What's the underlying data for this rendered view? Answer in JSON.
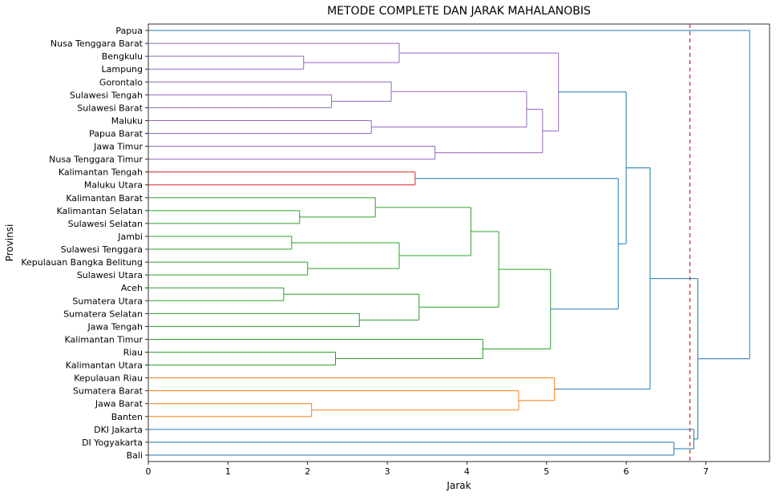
{
  "chart_data": {
    "type": "dendrogram",
    "title": "METODE COMPLETE DAN JARAK MAHALANOBIS",
    "xlabel": "Jarak",
    "ylabel": "Provinsi",
    "xlim": [
      0,
      7.8
    ],
    "xticks": [
      0,
      1,
      2,
      3,
      4,
      5,
      6,
      7
    ],
    "cut_line": 6.8,
    "colors": {
      "purple": "#9467bd",
      "red": "#d62728",
      "green": "#2ca02c",
      "orange": "#ff7f0e",
      "blue": "#1f77b4"
    },
    "leaves": [
      {
        "label": "Papua",
        "cluster": "blue"
      },
      {
        "label": "Nusa Tenggara Barat",
        "cluster": "purple"
      },
      {
        "label": "Bengkulu",
        "cluster": "purple"
      },
      {
        "label": "Lampung",
        "cluster": "purple"
      },
      {
        "label": "Gorontalo",
        "cluster": "purple"
      },
      {
        "label": "Sulawesi Tengah",
        "cluster": "purple"
      },
      {
        "label": "Sulawesi Barat",
        "cluster": "purple"
      },
      {
        "label": "Maluku",
        "cluster": "purple"
      },
      {
        "label": "Papua Barat",
        "cluster": "purple"
      },
      {
        "label": "Jawa Timur",
        "cluster": "purple"
      },
      {
        "label": "Nusa Tenggara Timur",
        "cluster": "purple"
      },
      {
        "label": "Kalimantan Tengah",
        "cluster": "red"
      },
      {
        "label": "Maluku Utara",
        "cluster": "red"
      },
      {
        "label": "Kalimantan Barat",
        "cluster": "green"
      },
      {
        "label": "Kalimantan Selatan",
        "cluster": "green"
      },
      {
        "label": "Sulawesi Selatan",
        "cluster": "green"
      },
      {
        "label": "Jambi",
        "cluster": "green"
      },
      {
        "label": "Sulawesi Tenggara",
        "cluster": "green"
      },
      {
        "label": "Kepulauan Bangka Belitung",
        "cluster": "green"
      },
      {
        "label": "Sulawesi Utara",
        "cluster": "green"
      },
      {
        "label": "Aceh",
        "cluster": "green"
      },
      {
        "label": "Sumatera Utara",
        "cluster": "green"
      },
      {
        "label": "Sumatera Selatan",
        "cluster": "green"
      },
      {
        "label": "Jawa Tengah",
        "cluster": "green"
      },
      {
        "label": "Kalimantan Timur",
        "cluster": "green"
      },
      {
        "label": "Riau",
        "cluster": "green"
      },
      {
        "label": "Kalimantan Utara",
        "cluster": "green"
      },
      {
        "label": "Kepulauan Riau",
        "cluster": "orange"
      },
      {
        "label": "Sumatera Barat",
        "cluster": "orange"
      },
      {
        "label": "Jawa Barat",
        "cluster": "orange"
      },
      {
        "label": "Banten",
        "cluster": "orange"
      },
      {
        "label": "DKI Jakarta",
        "cluster": "blue"
      },
      {
        "label": "DI Yogyakarta",
        "cluster": "blue"
      },
      {
        "label": "Bali",
        "cluster": "blue"
      }
    ],
    "merges": [
      {
        "id": "m_beng_lamp",
        "left": "Bengkulu",
        "right": "Lampung",
        "dist": 1.95,
        "color": "purple"
      },
      {
        "id": "m_ntb_bl",
        "left": "Nusa Tenggara Barat",
        "right": "m_beng_lamp",
        "dist": 3.15,
        "color": "purple"
      },
      {
        "id": "m_st_sb",
        "left": "Sulawesi Tengah",
        "right": "Sulawesi Barat",
        "dist": 2.3,
        "color": "purple"
      },
      {
        "id": "m_gor_stsb",
        "left": "Gorontalo",
        "right": "m_st_sb",
        "dist": 3.05,
        "color": "purple"
      },
      {
        "id": "m_mal_pb",
        "left": "Maluku",
        "right": "Papua Barat",
        "dist": 2.8,
        "color": "purple"
      },
      {
        "id": "m_gor_mal",
        "left": "m_gor_stsb",
        "right": "m_mal_pb",
        "dist": 4.75,
        "color": "purple"
      },
      {
        "id": "m_jt_ntt",
        "left": "Jawa Timur",
        "right": "Nusa Tenggara Timur",
        "dist": 3.6,
        "color": "purple"
      },
      {
        "id": "m_gm_jtntt",
        "left": "m_gor_mal",
        "right": "m_jt_ntt",
        "dist": 4.95,
        "color": "purple"
      },
      {
        "id": "m_ntb_all",
        "left": "m_ntb_bl",
        "right": "m_gm_jtntt",
        "dist": 5.15,
        "color": "purple"
      },
      {
        "id": "m_kt_mu",
        "left": "Kalimantan Tengah",
        "right": "Maluku Utara",
        "dist": 3.35,
        "color": "red"
      },
      {
        "id": "m_ks_ss",
        "left": "Kalimantan Selatan",
        "right": "Sulawesi Selatan",
        "dist": 1.9,
        "color": "green"
      },
      {
        "id": "m_kb_ksss",
        "left": "Kalimantan Barat",
        "right": "m_ks_ss",
        "dist": 2.85,
        "color": "green"
      },
      {
        "id": "m_ja_stg",
        "left": "Jambi",
        "right": "Sulawesi Tenggara",
        "dist": 1.8,
        "color": "green"
      },
      {
        "id": "m_bb_su",
        "left": "Kepulauan Bangka Belitung",
        "right": "Sulawesi Utara",
        "dist": 2.0,
        "color": "green"
      },
      {
        "id": "m_jastg_bbsu",
        "left": "m_ja_stg",
        "right": "m_bb_su",
        "dist": 3.15,
        "color": "green"
      },
      {
        "id": "m_kb_jabb",
        "left": "m_kb_ksss",
        "right": "m_jastg_bbsu",
        "dist": 4.05,
        "color": "green"
      },
      {
        "id": "m_ac_sumut",
        "left": "Aceh",
        "right": "Sumatera Utara",
        "dist": 1.7,
        "color": "green"
      },
      {
        "id": "m_sumsel_jt",
        "left": "Sumatera Selatan",
        "right": "Jawa Tengah",
        "dist": 2.65,
        "color": "green"
      },
      {
        "id": "m_ac_sj",
        "left": "m_ac_sumut",
        "right": "m_sumsel_jt",
        "dist": 3.4,
        "color": "green"
      },
      {
        "id": "m_kbgrp_acgrp",
        "left": "m_kb_jabb",
        "right": "m_ac_sj",
        "dist": 4.4,
        "color": "green"
      },
      {
        "id": "m_ri_ku",
        "left": "Riau",
        "right": "Kalimantan Utara",
        "dist": 2.35,
        "color": "green"
      },
      {
        "id": "m_kt_riku",
        "left": "Kalimantan Timur",
        "right": "m_ri_ku",
        "dist": 4.2,
        "color": "green"
      },
      {
        "id": "m_green_all",
        "left": "m_kbgrp_acgrp",
        "right": "m_kt_riku",
        "dist": 5.05,
        "color": "green"
      },
      {
        "id": "m_jb_ban",
        "left": "Jawa Barat",
        "right": "Banten",
        "dist": 2.05,
        "color": "orange"
      },
      {
        "id": "m_sb_jbban",
        "left": "Sumatera Barat",
        "right": "m_jb_ban",
        "dist": 4.65,
        "color": "orange"
      },
      {
        "id": "m_kr_sb",
        "left": "Kepulauan Riau",
        "right": "m_sb_jbban",
        "dist": 5.1,
        "color": "orange"
      },
      {
        "id": "m_red_green",
        "left": "m_kt_mu",
        "right": "m_green_all",
        "dist": 5.9,
        "color": "blue"
      },
      {
        "id": "m_purple_rg",
        "left": "m_ntb_all",
        "right": "m_red_green",
        "dist": 6.0,
        "color": "blue"
      },
      {
        "id": "m_prg_or",
        "left": "m_purple_rg",
        "right": "m_kr_sb",
        "dist": 6.3,
        "color": "blue"
      },
      {
        "id": "m_diy_bali",
        "left": "DI Yogyakarta",
        "right": "Bali",
        "dist": 6.6,
        "color": "blue"
      },
      {
        "id": "m_dki_diybali",
        "left": "DKI Jakarta",
        "right": "m_diy_bali",
        "dist": 6.85,
        "color": "blue"
      },
      {
        "id": "m_big_dki",
        "left": "m_prg_or",
        "right": "m_dki_diybali",
        "dist": 6.9,
        "color": "blue"
      },
      {
        "id": "m_root",
        "left": "Papua",
        "right": "m_big_dki",
        "dist": 7.55,
        "color": "blue"
      }
    ]
  }
}
